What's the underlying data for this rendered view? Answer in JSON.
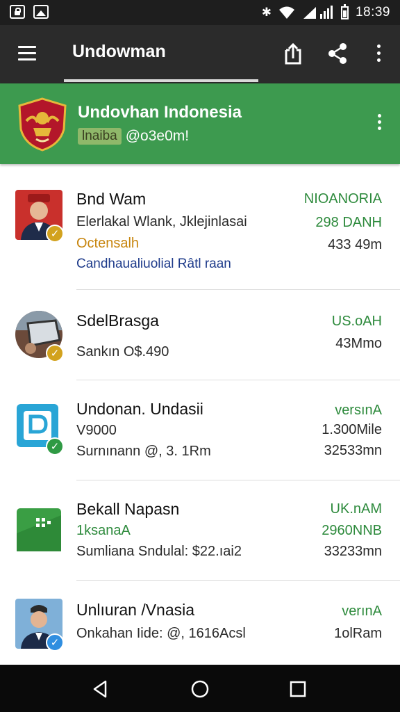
{
  "status_bar": {
    "time": "18:39",
    "icons": [
      "lock-icon",
      "image-icon",
      "bluetooth-icon",
      "wifi-icon",
      "signal-icon",
      "battery-icon"
    ]
  },
  "app_bar": {
    "title": "Undowman",
    "actions": [
      "menu-icon",
      "upload-icon",
      "share-icon",
      "more-vert-icon"
    ]
  },
  "profile": {
    "name": "Undovhan Indonesia",
    "tag": "lnaiba",
    "handle": "@o3e0m!"
  },
  "list": [
    {
      "avatar": "person-avatar",
      "badge": "gold",
      "title": "Bnd Wam",
      "lines": [
        "Elerlakal Wlank, Jklejinlasai",
        "Octensalh",
        "Candhaualiuolial Râtl raan"
      ],
      "right": [
        "NIOANORIA",
        "298 DANH",
        "433 49m"
      ]
    },
    {
      "avatar": "car-avatar",
      "badge": "gold",
      "title": "SdelBrasga",
      "lines": [
        "Sankın O$.490"
      ],
      "right": [
        "US.oAH",
        "43Mmo"
      ]
    },
    {
      "avatar": "app-logo-avatar",
      "badge": "green",
      "title": "Undonan. Undasii",
      "lines": [
        "V9000",
        "Surnınann @, 3. 1Rm"
      ],
      "right": [
        "versınA",
        "1.300Mile",
        "32533mn"
      ]
    },
    {
      "avatar": "sheet-icon-avatar",
      "badge": "none",
      "title": "Bekall Napasn",
      "lines": [
        "1ksanaA",
        "Sumliana Sndulal: $22.ıai2"
      ],
      "right": [
        "UK.nAM",
        "2960NNB",
        "33233mn"
      ]
    },
    {
      "avatar": "person-avatar",
      "badge": "blue",
      "title": "Unlıuran /Vnasia",
      "lines": [
        "Onkahan Iide: @, 1616Acsl"
      ],
      "right": [
        "verınA",
        "1olRam"
      ]
    }
  ],
  "colors": {
    "status_bar": "#1e1e1e",
    "app_bar": "#2b2b2b",
    "profile_bg": "#3d9a4f",
    "accent_green": "#2d8a3c",
    "accent_orange": "#c7850d",
    "nav_bar": "#0a0a0a"
  },
  "nav": [
    "back-icon",
    "home-icon",
    "recents-icon"
  ]
}
